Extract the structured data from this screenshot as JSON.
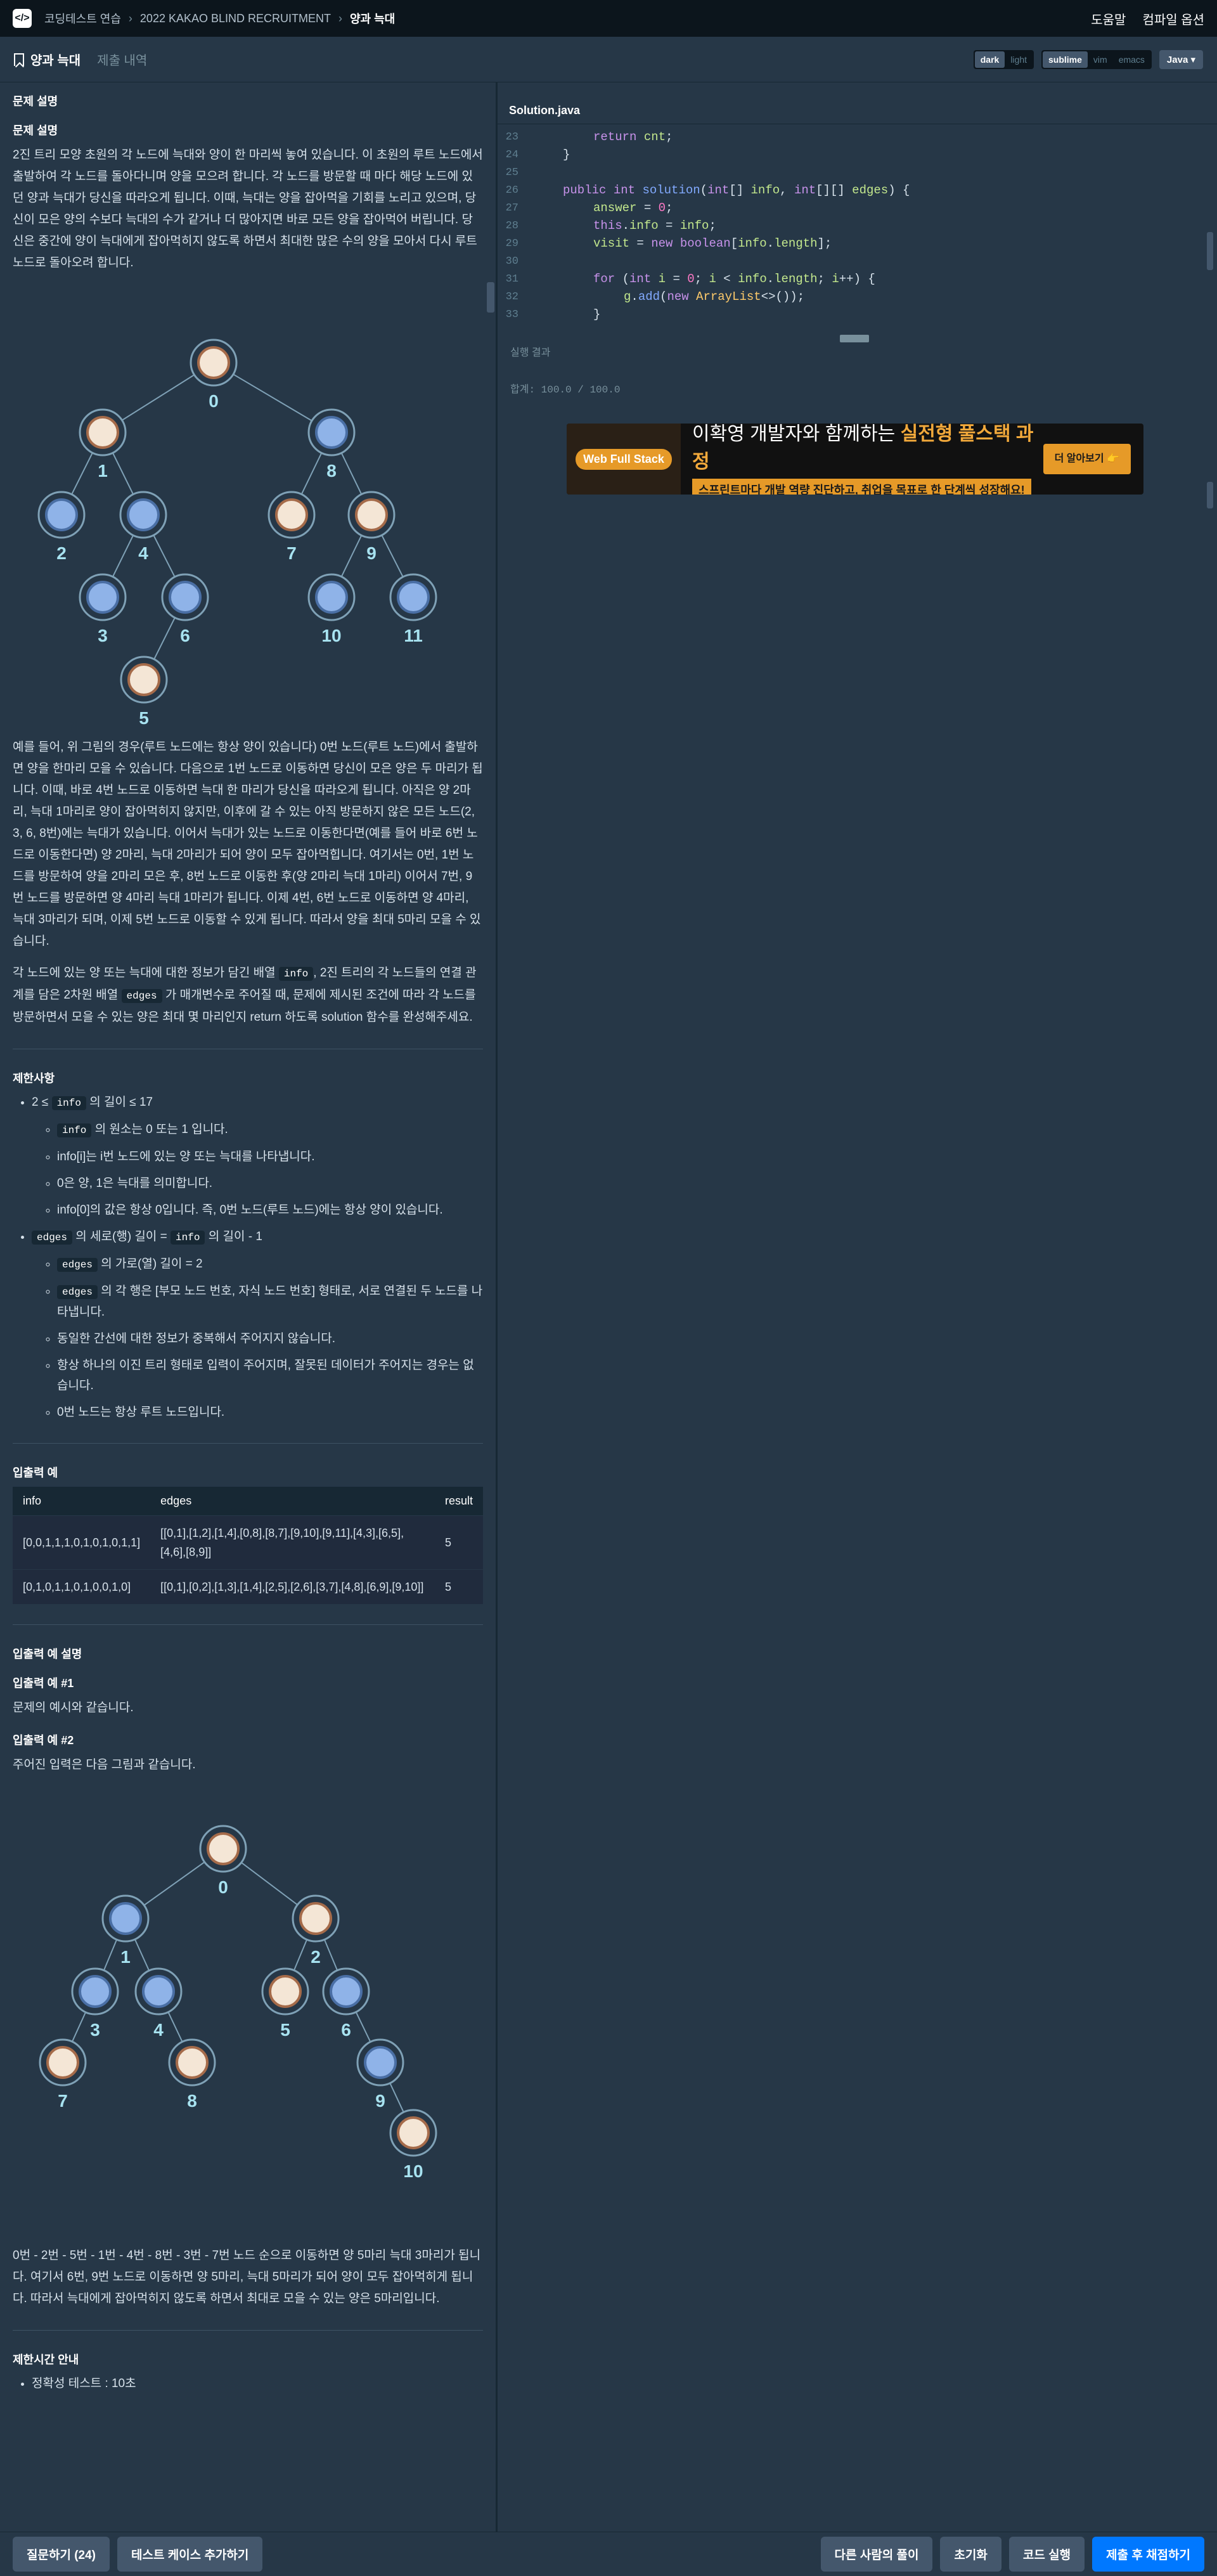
{
  "topbar": {
    "breadcrumbs": [
      "코딩테스트 연습",
      "2022 KAKAO BLIND RECRUITMENT",
      "양과 늑대"
    ],
    "help": "도움말",
    "compiler_options": "컴파일 옵션"
  },
  "tabs": {
    "problem": "양과 늑대",
    "submissions": "제출 내역"
  },
  "themes": {
    "dark": "dark",
    "light": "light",
    "sublime": "sublime",
    "vim": "vim",
    "emacs": "emacs"
  },
  "language": "Java",
  "problem": {
    "section_title": "문제 설명",
    "subtitle": "문제 설명",
    "para1": "2진 트리 모양 초원의 각 노드에 늑대와 양이 한 마리씩 놓여 있습니다. 이 초원의 루트 노드에서 출발하여 각 노드를 돌아다니며 양을 모으려 합니다. 각 노드를 방문할 때 마다 해당 노드에 있던 양과 늑대가 당신을 따라오게 됩니다. 이때, 늑대는 양을 잡아먹을 기회를 노리고 있으며, 당신이 모은 양의 수보다 늑대의 수가 같거나 더 많아지면 바로 모든 양을 잡아먹어 버립니다. 당신은 중간에 양이 늑대에게 잡아먹히지 않도록 하면서 최대한 많은 수의 양을 모아서 다시 루트 노드로 돌아오려 합니다.",
    "tree1_labels": [
      "0",
      "1",
      "8",
      "2",
      "4",
      "7",
      "9",
      "3",
      "6",
      "10",
      "11",
      "5"
    ],
    "para2": "예를 들어, 위 그림의 경우(루트 노드에는 항상 양이 있습니다) 0번 노드(루트 노드)에서 출발하면 양을 한마리 모을 수 있습니다. 다음으로 1번 노드로 이동하면 당신이 모은 양은 두 마리가 됩니다. 이때, 바로 4번 노드로 이동하면 늑대 한 마리가 당신을 따라오게 됩니다. 아직은 양 2마리, 늑대 1마리로 양이 잡아먹히지 않지만, 이후에 갈 수 있는 아직 방문하지 않은 모든 노드(2, 3, 6, 8번)에는 늑대가 있습니다. 이어서 늑대가 있는 노드로 이동한다면(예를 들어 바로 6번 노드로 이동한다면) 양 2마리, 늑대 2마리가 되어 양이 모두 잡아먹힙니다. 여기서는 0번, 1번 노드를 방문하여 양을 2마리 모은 후, 8번 노드로 이동한 후(양 2마리 늑대 1마리) 이어서 7번, 9번 노드를 방문하면 양 4마리 늑대 1마리가 됩니다. 이제 4번, 6번 노드로 이동하면 양 4마리, 늑대 3마리가 되며, 이제 5번 노드로 이동할 수 있게 됩니다. 따라서 양을 최대 5마리 모을 수 있습니다.",
    "para3_a": "각 노드에 있는 양 또는 늑대에 대한 정보가 담긴 배열",
    "para3_code1": "info",
    "para3_b": ", 2진 트리의 각 노드들의 연결 관계를 담은 2차원 배열",
    "para3_code2": "edges",
    "para3_c": "가 매개변수로 주어질 때, 문제에 제시된 조건에 따라 각 노드를 방문하면서 모을 수 있는 양은 최대 몇 마리인지 return 하도록 solution 함수를 완성해주세요."
  },
  "limits": {
    "title": "제한사항",
    "l1_pre": "2 ≤",
    "l1_code": "info",
    "l1_post": "의 길이 ≤ 17",
    "l1_sub1_code": "info",
    "l1_sub1_post": "의 원소는 0 또는 1 입니다.",
    "l1_sub2": "info[i]는 i번 노드에 있는 양 또는 늑대를 나타냅니다.",
    "l1_sub3": "0은 양, 1은 늑대를 의미합니다.",
    "l1_sub4": "info[0]의 값은 항상 0입니다. 즉, 0번 노드(루트 노드)에는 항상 양이 있습니다.",
    "l2_code1": "edges",
    "l2_mid": "의 세로(행) 길이 =",
    "l2_code2": "info",
    "l2_post": "의 길이 - 1",
    "l2_sub1_code": "edges",
    "l2_sub1_post": "의 가로(열) 길이 = 2",
    "l2_sub2_code": "edges",
    "l2_sub2_post": "의 각 행은 [부모 노드 번호, 자식 노드 번호] 형태로, 서로 연결된 두 노드를 나타냅니다.",
    "l2_sub3": "동일한 간선에 대한 정보가 중복해서 주어지지 않습니다.",
    "l2_sub4": "항상 하나의 이진 트리 형태로 입력이 주어지며, 잘못된 데이터가 주어지는 경우는 없습니다.",
    "l2_sub5": "0번 노드는 항상 루트 노드입니다."
  },
  "io": {
    "title": "입출력 예",
    "headers": [
      "info",
      "edges",
      "result"
    ],
    "rows": [
      [
        "[0,0,1,1,1,0,1,0,1,0,1,1]",
        "[[0,1],[1,2],[1,4],[0,8],[8,7],[9,10],[9,11],[4,3],[6,5],[4,6],[8,9]]",
        "5"
      ],
      [
        "[0,1,0,1,1,0,1,0,0,1,0]",
        "[[0,1],[0,2],[1,3],[1,4],[2,5],[2,6],[3,7],[4,8],[6,9],[9,10]]",
        "5"
      ]
    ]
  },
  "io_explain": {
    "title": "입출력 예 설명",
    "ex1_title": "입출력 예 #1",
    "ex1_text": "문제의 예시와 같습니다.",
    "ex2_title": "입출력 예 #2",
    "ex2_text": "주어진 입력은 다음 그림과 같습니다.",
    "tree2_labels": [
      "0",
      "1",
      "2",
      "3",
      "4",
      "5",
      "6",
      "7",
      "8",
      "9",
      "10"
    ],
    "ex2_result": "0번 - 2번 - 5번 - 1번 - 4번 - 8번 - 3번 - 7번 노드 순으로 이동하면 양 5마리 늑대 3마리가 됩니다. 여기서 6번, 9번 노드로 이동하면 양 5마리, 늑대 5마리가 되어 양이 모두 잡아먹히게 됩니다. 따라서 늑대에게 잡아먹히지 않도록 하면서 최대로 모을 수 있는 양은 5마리입니다."
  },
  "time_limit": {
    "title": "제한시간 안내",
    "item": "정확성 테스트 : 10초"
  },
  "editor": {
    "filename": "Solution.java",
    "line_numbers": [
      "23",
      "24",
      "25",
      "26",
      "27",
      "28",
      "29",
      "30",
      "31",
      "32",
      "33"
    ],
    "result_label": "실행 결과",
    "result_text": "합계: 100.0 / 100.0"
  },
  "ad": {
    "logo": "Web Full Stack",
    "headline_a": "이확영 개발자와 함께하는 ",
    "headline_b": "실전형 풀스택 과정",
    "sub": "스프린트마다 개발 역량 진단하고, 취업을 목표로 한 단계씩 성장해요!",
    "button": "더 알아보기 👉"
  },
  "bottom": {
    "questions": "질문하기 (24)",
    "add_testcase": "테스트 케이스 추가하기",
    "others": "다른 사람의 풀이",
    "reset": "초기화",
    "run": "코드 실행",
    "submit": "제출 후 채점하기"
  }
}
